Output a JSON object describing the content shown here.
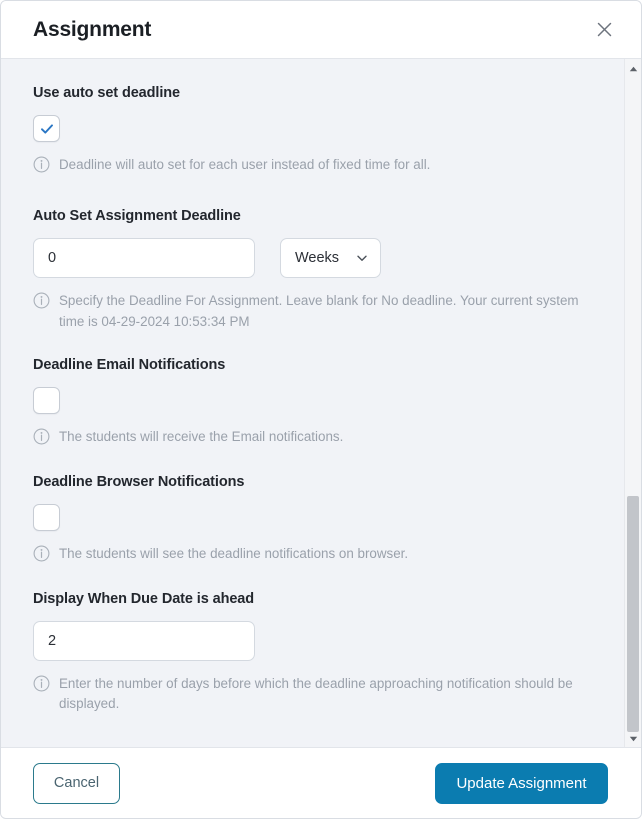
{
  "header": {
    "title": "Assignment",
    "close_icon": "close-icon"
  },
  "body": {
    "sections": [
      {
        "label": "Use auto set deadline",
        "control": "checkbox",
        "checked": true,
        "helper": "Deadline will auto set for each user instead of fixed time for all."
      },
      {
        "label": "Auto Set Assignment Deadline",
        "control": "number-with-unit",
        "value": "0",
        "unit": "Weeks",
        "helper": "Specify the Deadline For Assignment. Leave blank for No deadline. Your current system time is 04-29-2024 10:53:34 PM"
      },
      {
        "label": "Deadline Email Notifications",
        "control": "checkbox",
        "checked": false,
        "helper": "The students will receive the Email notifications."
      },
      {
        "label": "Deadline Browser Notifications",
        "control": "checkbox",
        "checked": false,
        "helper": "The students will see the deadline notifications on browser."
      },
      {
        "label": "Display When Due Date is ahead",
        "control": "number",
        "value": "2",
        "helper": "Enter the number of days before which the deadline approaching notification should be displayed."
      }
    ]
  },
  "scrollbar": {
    "up_icon": "triangle-up-icon",
    "down_icon": "triangle-down-icon"
  },
  "footer": {
    "cancel_label": "Cancel",
    "submit_label": "Update Assignment"
  },
  "colors": {
    "primary": "#0b7cb0",
    "cancel_border": "#2b7a8c",
    "checkbox_check": "#2a76c4",
    "body_bg": "#f1f3f7",
    "helper_text": "#9aa1ab"
  }
}
